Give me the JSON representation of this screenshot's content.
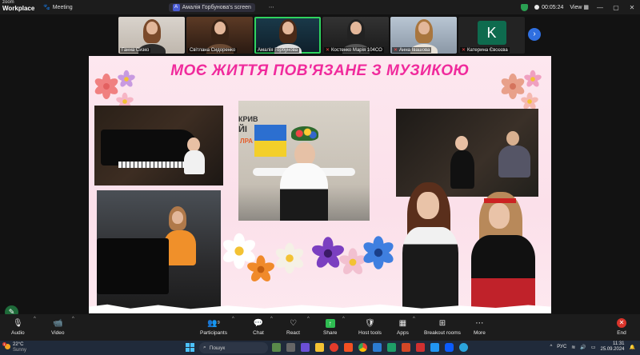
{
  "topbar": {
    "brand_line1": "zoom",
    "brand_line2": "Workplace",
    "meeting_label": "Meeting",
    "share_initial": "A",
    "share_label": "Амалія Горбунова's screen",
    "timer": "00:05:24",
    "view_label": "View"
  },
  "participants": [
    {
      "name": "Ганна Сизко",
      "muted": false
    },
    {
      "name": "Світлана Сидоренко",
      "muted": false
    },
    {
      "name": "Амалія Горбунова",
      "muted": false,
      "active": true
    },
    {
      "name": "Костенко Марія 104СО",
      "muted": true
    },
    {
      "name": "Анна Івашова",
      "muted": true
    },
    {
      "name": "Катерина Євсєєва",
      "muted": true,
      "initial": "K"
    }
  ],
  "slide": {
    "title": "МОЄ ЖИТТЯ ПОВ'ЯЗАНЕ З МУЗИКОЮ",
    "banner_line1": "КРИВ",
    "banner_line2": "ЙІ",
    "banner_line3": "ЛРА"
  },
  "toolbar": {
    "audio": "Audio",
    "video": "Video",
    "participants": "Participants",
    "participants_count": "9",
    "chat": "Chat",
    "react": "React",
    "share": "Share",
    "host_tools": "Host tools",
    "apps": "Apps",
    "breakout": "Breakout rooms",
    "more": "More",
    "end": "End"
  },
  "taskbar": {
    "temperature": "22°C",
    "weather_text": "Sunny",
    "weather_badge": "1",
    "search_placeholder": "Пошук",
    "language": "РУС",
    "time": "11:31",
    "date": "25.09.2024"
  },
  "colors": {
    "title_pink": "#f02a9c",
    "zoom_blue": "#2f6fe0",
    "active_green": "#2fd35f",
    "share_green": "#2fbd52",
    "end_red": "#d9342b"
  }
}
